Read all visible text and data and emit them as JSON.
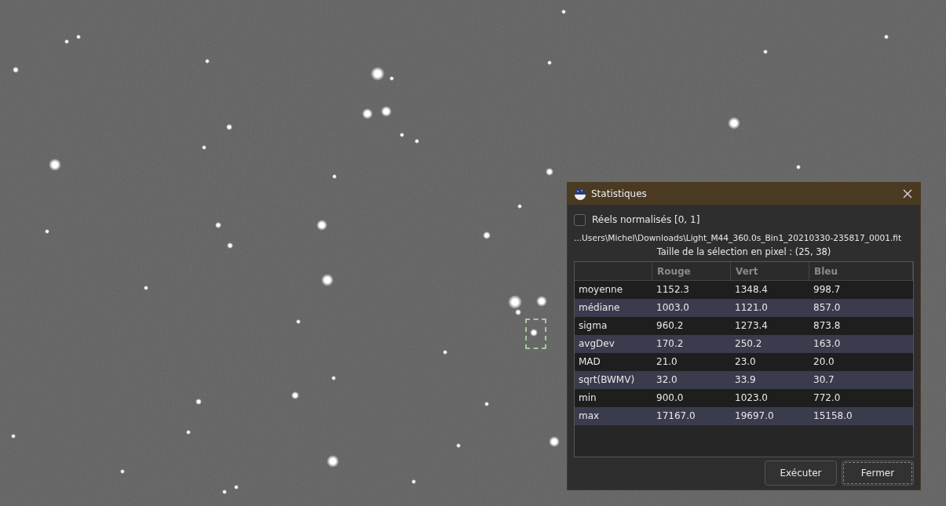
{
  "dialog": {
    "title": "Statistiques",
    "normalized_checkbox": {
      "label": "Réels normalisés [0, 1]",
      "checked": false
    },
    "file_path": "...Users\\Michel\\Downloads\\Light_M44_360.0s_Bin1_20210330-235817_0001.fit",
    "selection_size": "Taille de la sélection en pixel : (25, 38)",
    "table": {
      "columns": [
        "Rouge",
        "Vert",
        "Bleu"
      ],
      "rows": [
        {
          "label": "moyenne",
          "values": [
            "1152.3",
            "1348.4",
            "998.7"
          ]
        },
        {
          "label": "médiane",
          "values": [
            "1003.0",
            "1121.0",
            "857.0"
          ]
        },
        {
          "label": "sigma",
          "values": [
            "960.2",
            "1273.4",
            "873.8"
          ]
        },
        {
          "label": "avgDev",
          "values": [
            "170.2",
            "250.2",
            "163.0"
          ]
        },
        {
          "label": "MAD",
          "values": [
            "21.0",
            "23.0",
            "20.0"
          ]
        },
        {
          "label": "sqrt(BWMV)",
          "values": [
            "32.0",
            "33.9",
            "30.7"
          ]
        },
        {
          "label": "min",
          "values": [
            "900.0",
            "1023.0",
            "772.0"
          ]
        },
        {
          "label": "max",
          "values": [
            "17167.0",
            "19697.0",
            "15158.0"
          ]
        }
      ]
    },
    "buttons": [
      {
        "label": "Exécuter",
        "focused": false
      },
      {
        "label": "Fermer",
        "focused": true
      }
    ]
  }
}
